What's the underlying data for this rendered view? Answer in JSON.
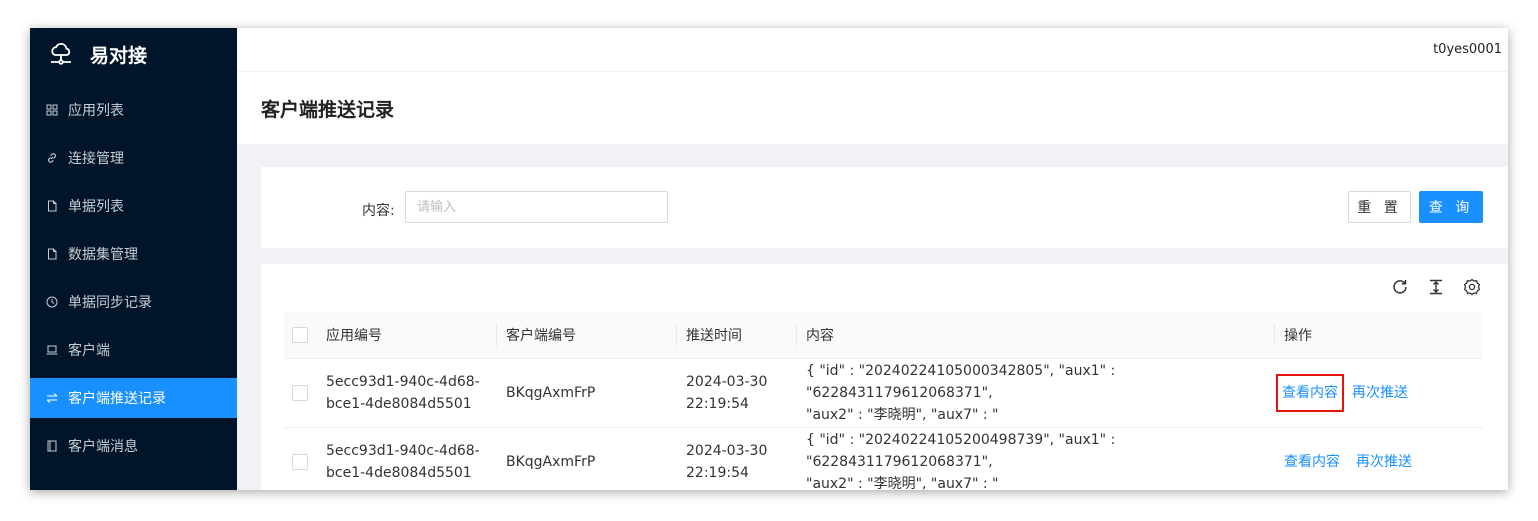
{
  "app": {
    "name": "易对接"
  },
  "sidebar": {
    "items": [
      {
        "label": "应用列表",
        "icon": "grid-icon"
      },
      {
        "label": "连接管理",
        "icon": "link-icon"
      },
      {
        "label": "单据列表",
        "icon": "file-icon"
      },
      {
        "label": "数据集管理",
        "icon": "file-icon"
      },
      {
        "label": "单据同步记录",
        "icon": "clock-icon"
      },
      {
        "label": "客户端",
        "icon": "laptop-icon"
      },
      {
        "label": "客户端推送记录",
        "icon": "swap-icon",
        "active": true
      },
      {
        "label": "客户端消息",
        "icon": "book-icon"
      }
    ]
  },
  "header": {
    "user": "t0yes0001"
  },
  "page": {
    "title": "客户端推送记录"
  },
  "search": {
    "label": "内容:",
    "placeholder": "请输入",
    "reset_label": "重 置",
    "query_label": "查 询"
  },
  "toolbar": {
    "icons": [
      "reload-icon",
      "column-height-icon",
      "setting-icon"
    ]
  },
  "table": {
    "columns": [
      "应用编号",
      "客户端编号",
      "推送时间",
      "内容",
      "操作"
    ],
    "rows": [
      {
        "app_id_1": "5ecc93d1-940c-4d68-",
        "app_id_2": "bce1-4de8084d5501",
        "client_id": "BKqgAxmFrP",
        "date": "2024-03-30",
        "time": "22:19:54",
        "content_1": "{ \"id\" : \"20240224105000342805\", \"aux1\" : \"6228431179612068371\",",
        "content_2": "\"aux2\" : \"李晓明\", \"aux7\" : \"",
        "action_view": "查看内容",
        "action_repush": "再次推送"
      },
      {
        "app_id_1": "5ecc93d1-940c-4d68-",
        "app_id_2": "bce1-4de8084d5501",
        "client_id": "BKqgAxmFrP",
        "date": "2024-03-30",
        "time": "22:19:54",
        "content_1": "{ \"id\" : \"20240224105200498739\", \"aux1\" : \"6228431179612068371\",",
        "content_2": "\"aux2\" : \"李晓明\", \"aux7\" : \"",
        "action_view": "查看内容",
        "action_repush": "再次推送"
      }
    ]
  },
  "colors": {
    "sidebar_bg": "#001529",
    "accent": "#1890ff",
    "highlight": "#e8120c"
  }
}
